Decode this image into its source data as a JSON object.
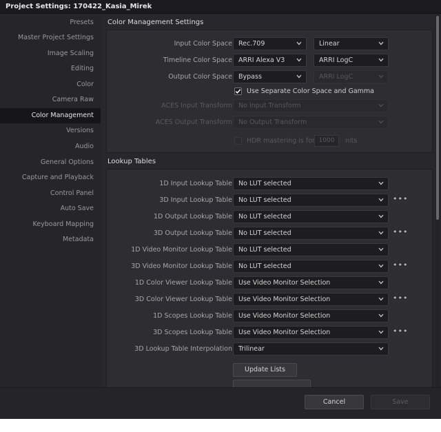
{
  "window": {
    "title": "Project Settings:  170422_Kasia_Mirek"
  },
  "sidebar": {
    "items": [
      {
        "label": "Presets"
      },
      {
        "label": "Master Project Settings"
      },
      {
        "label": "Image Scaling"
      },
      {
        "label": "Editing"
      },
      {
        "label": "Color"
      },
      {
        "label": "Camera Raw"
      },
      {
        "label": "Color Management",
        "active": true
      },
      {
        "label": "Versions"
      },
      {
        "label": "Audio"
      },
      {
        "label": "General Options"
      },
      {
        "label": "Capture and Playback"
      },
      {
        "label": "Control Panel"
      },
      {
        "label": "Auto Save"
      },
      {
        "label": "Keyboard Mapping"
      },
      {
        "label": "Metadata"
      }
    ]
  },
  "color_management": {
    "section_title": "Color Management Settings",
    "input_color_space": {
      "label": "Input Color Space",
      "value": "Rec.709",
      "gamma": "Linear"
    },
    "timeline_color_space": {
      "label": "Timeline Color Space",
      "value": "ARRI Alexa V3",
      "gamma": "ARRI LogC"
    },
    "output_color_space": {
      "label": "Output Color Space",
      "value": "Bypass",
      "gamma": "ARRI LogC"
    },
    "separate_gamma": {
      "label": "Use Separate Color Space and Gamma",
      "checked": true
    },
    "aces_input": {
      "label": "ACES Input Transform",
      "value": "No Input Transform"
    },
    "aces_output": {
      "label": "ACES Output Transform",
      "value": "No Output Transform"
    },
    "hdr": {
      "label": "HDR mastering is for",
      "value": "1000",
      "unit": "nits",
      "checked": false
    }
  },
  "lookup_tables": {
    "section_title": "Lookup Tables",
    "rows": [
      {
        "label": "1D Input Lookup Table",
        "value": "No LUT selected",
        "more": false
      },
      {
        "label": "3D Input Lookup Table",
        "value": "No LUT selected",
        "more": true
      },
      {
        "label": "1D Output Lookup Table",
        "value": "No LUT selected",
        "more": false
      },
      {
        "label": "3D Output Lookup Table",
        "value": "No LUT selected",
        "more": true
      },
      {
        "label": "1D Video Monitor Lookup Table",
        "value": "No LUT selected",
        "more": false
      },
      {
        "label": "3D Video Monitor Lookup Table",
        "value": "No LUT selected",
        "more": true
      },
      {
        "label": "1D Color Viewer Lookup Table",
        "value": "Use Video Monitor Selection",
        "more": false
      },
      {
        "label": "3D Color Viewer Lookup Table",
        "value": "Use Video Monitor Selection",
        "more": true
      },
      {
        "label": "1D Scopes Lookup Table",
        "value": "Use Video Monitor Selection",
        "more": false
      },
      {
        "label": "3D Scopes Lookup Table",
        "value": "Use Video Monitor Selection",
        "more": true
      },
      {
        "label": "3D Lookup Table Interpolation",
        "value": "Trilinear",
        "more": false
      }
    ],
    "more_glyph": "•••",
    "update_lists": "Update Lists"
  },
  "footer": {
    "cancel": "Cancel",
    "save": "Save"
  },
  "icons": {
    "dropdown": "chevron-down-icon",
    "checkbox": "checkmark-icon",
    "more": "more-options-icon"
  },
  "colors": {
    "background": "#28282c",
    "sidebar_active": "#161618",
    "dropdown_bg": "#1d1d20"
  }
}
